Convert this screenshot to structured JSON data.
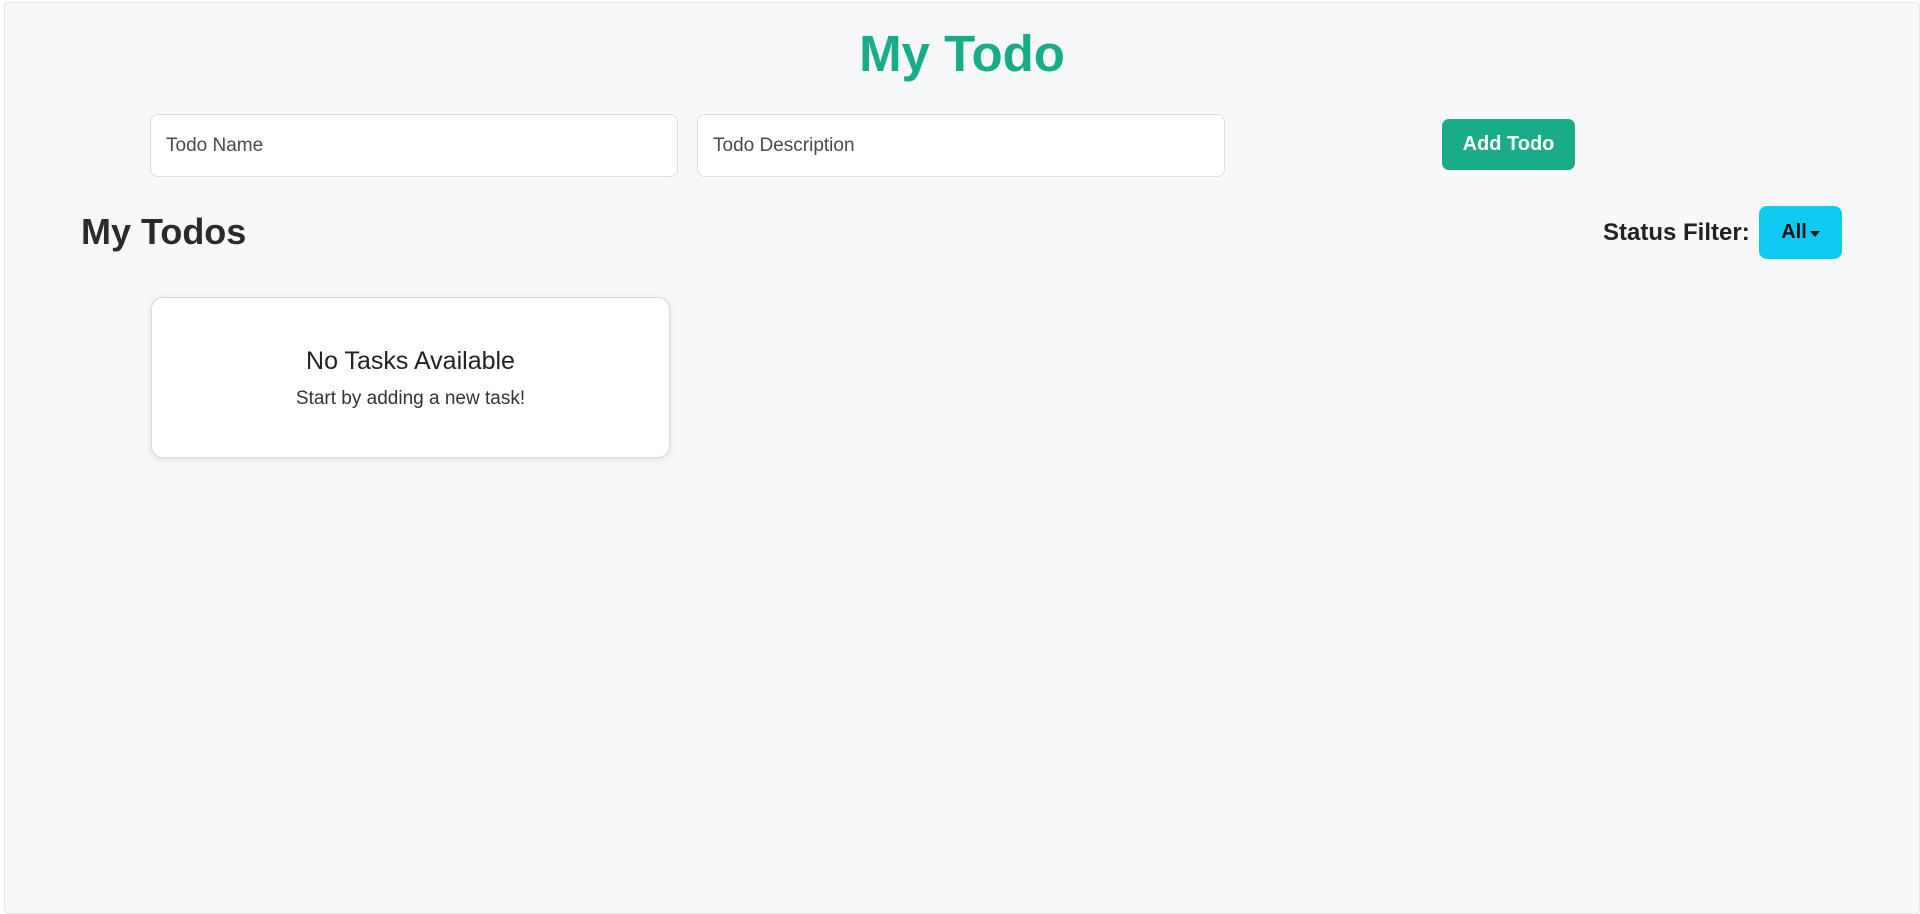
{
  "app": {
    "title": "My Todo"
  },
  "form": {
    "name_placeholder": "Todo Name",
    "name_value": "",
    "description_placeholder": "Todo Description",
    "description_value": "",
    "add_label": "Add Todo"
  },
  "list": {
    "heading": "My Todos",
    "filter_label": "Status Filter:",
    "filter_selected": "All",
    "empty_title": "No Tasks Available",
    "empty_message": "Start by adding a new task!"
  },
  "colors": {
    "accent": "#18ad88",
    "filter_button": "#0fcaf0",
    "background": "#f7f8fa"
  }
}
